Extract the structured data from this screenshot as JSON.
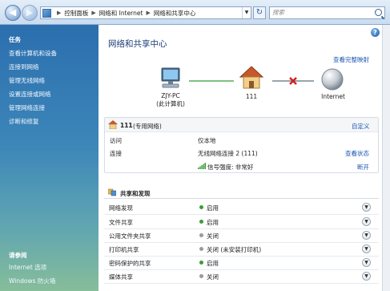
{
  "address": {
    "crumbs": [
      "控制面板",
      "网络和 Internet",
      "网络和共享中心"
    ],
    "search_placeholder": "搜索"
  },
  "sidebar": {
    "tasks_heading": "任务",
    "tasks": [
      "查看计算机和设备",
      "连接到网络",
      "管理无线网络",
      "设置连接或网络",
      "管理网络连接",
      "诊断和修复"
    ],
    "see_also_heading": "请参阅",
    "see_also": [
      "Internet 选项",
      "Windows 防火墙"
    ]
  },
  "main": {
    "title": "网络和共享中心",
    "view_full_map": "查看完整映射",
    "map": {
      "computer_name": "ZJY-PC",
      "computer_sub": "(此计算机)",
      "network_name": "111",
      "internet_name": "Internet"
    },
    "network": {
      "name": "111",
      "type": "(专用网络)",
      "customize": "自定义",
      "access_label": "访问",
      "access_value": "仅本地",
      "connection_label": "连接",
      "connection_value": "无线网络连接 2 (111)",
      "view_status": "查看状态",
      "signal_text": "信号强度: 非常好",
      "disconnect": "断开"
    },
    "sharing": {
      "heading": "共享和发现",
      "rows": [
        {
          "name": "网络发现",
          "value": "启用",
          "on": true
        },
        {
          "name": "文件共享",
          "value": "启用",
          "on": true
        },
        {
          "name": "公用文件夹共享",
          "value": "关闭",
          "on": false
        },
        {
          "name": "打印机共享",
          "value": "关闭 (未安装打印机)",
          "on": false
        },
        {
          "name": "密码保护的共享",
          "value": "启用",
          "on": true
        },
        {
          "name": "媒体共享",
          "value": "关闭",
          "on": false
        }
      ]
    }
  },
  "colors": {
    "accent_link": "#1a55b0",
    "status_on": "#3a9d3a",
    "status_off": "#9a9a9a",
    "title": "#1e3f7a"
  }
}
